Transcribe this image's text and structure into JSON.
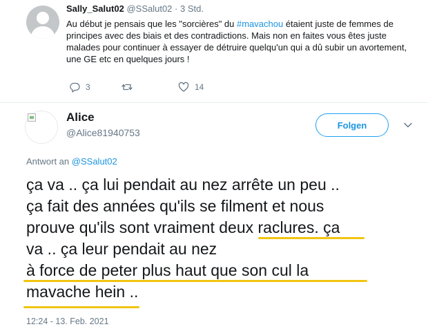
{
  "colors": {
    "accent": "#1da1f2",
    "link": "#1b95e0",
    "muted": "#657786",
    "underline": "#f1c40f"
  },
  "tweet1": {
    "name": "Sally_Salut02",
    "handle": "@SSalut02",
    "dot": "·",
    "time": "3 Std.",
    "text_pre": "Au début je pensais que les \"sorcières\" du ",
    "hashtag": "#mavachou",
    "text_post": " étaient juste de femmes de principes avec des biais et des contradictions. Mais non en faites vous êtes juste malades pour continuer à essayer de détruire quelqu'un qui a dû subir un avortement, une GE etc en quelques jours !",
    "replies": "3",
    "retweets": "",
    "likes": "14",
    "icons": [
      "reply-icon",
      "retweet-icon",
      "like-icon"
    ]
  },
  "tweet2": {
    "name": "Alice",
    "handle": "@Alice81940753",
    "follow_label": "Folgen",
    "reply_prefix": "Antwort an",
    "reply_to": "@SSalut02",
    "lines": [
      "ça va .. ça lui pendait au nez arrête un peu ..",
      "ça fait des années qu'ils se filment et nous",
      "prouve qu'ils sont vraiment deux raclures. ça",
      "va .. ça leur pendait au nez",
      "à force de peter plus haut que son cul la",
      "mavache hein .."
    ],
    "timestamp": "12:24 - 13. Feb. 2021",
    "icons": [
      "avatar-broken-image-icon",
      "chevron-down-icon"
    ]
  }
}
